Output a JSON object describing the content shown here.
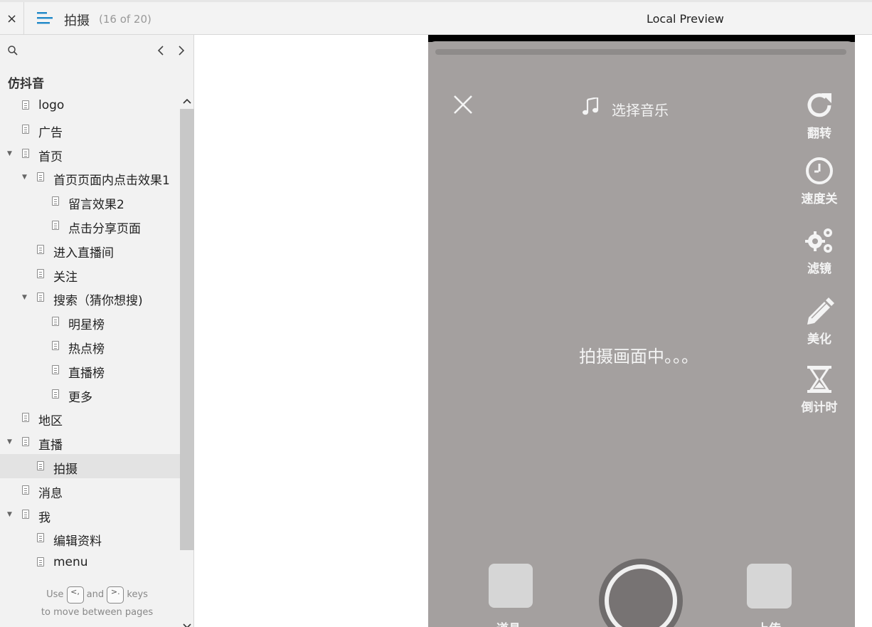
{
  "topbar": {
    "close_glyph": "×",
    "page_title": "拍摄",
    "page_count": "(16 of 20)",
    "preview_title": "Local Preview"
  },
  "sidebar": {
    "project_title": "仿抖音",
    "prev_glyph": "‹",
    "next_glyph": "›",
    "items": [
      {
        "label": "logo",
        "level": 1,
        "expanded": null
      },
      {
        "label": "广告",
        "level": 1,
        "expanded": null
      },
      {
        "label": "首页",
        "level": 1,
        "expanded": true
      },
      {
        "label": "首页页面内点击效果1",
        "level": 2,
        "expanded": true
      },
      {
        "label": "留言效果2",
        "level": 3,
        "expanded": null
      },
      {
        "label": "点击分享页面",
        "level": 3,
        "expanded": null
      },
      {
        "label": "进入直播间",
        "level": 2,
        "expanded": null
      },
      {
        "label": "关注",
        "level": 2,
        "expanded": null
      },
      {
        "label": "搜索（猜你想搜)",
        "level": 2,
        "expanded": true
      },
      {
        "label": "明星榜",
        "level": 3,
        "expanded": null
      },
      {
        "label": "热点榜",
        "level": 3,
        "expanded": null
      },
      {
        "label": "直播榜",
        "level": 3,
        "expanded": null
      },
      {
        "label": "更多",
        "level": 3,
        "expanded": null
      },
      {
        "label": "地区",
        "level": 1,
        "expanded": null
      },
      {
        "label": "直播",
        "level": 1,
        "expanded": true
      },
      {
        "label": "拍摄",
        "level": 2,
        "expanded": null,
        "active": true
      },
      {
        "label": "消息",
        "level": 1,
        "expanded": null
      },
      {
        "label": "我",
        "level": 1,
        "expanded": true
      },
      {
        "label": "编辑资料",
        "level": 2,
        "expanded": null
      },
      {
        "label": "menu",
        "level": 2,
        "expanded": null
      }
    ],
    "hint": {
      "use": "Use",
      "prev_key": "<,",
      "and": "and",
      "next_key": ">.",
      "keys": "keys",
      "line2": "to move between pages"
    }
  },
  "preview": {
    "music_label": "选择音乐",
    "flip_label": "翻转",
    "speed_label": "速度关",
    "filter_label": "滤镜",
    "beauty_label": "美化",
    "countdown_label": "倒计时",
    "center_text": "拍摄画面中。。。",
    "props_label": "道具",
    "upload_label": "上传"
  },
  "colors": {
    "phone_bg": "#a4a09f",
    "sidebar_bg": "#f2f2f2",
    "accent": "#1e88c8"
  }
}
